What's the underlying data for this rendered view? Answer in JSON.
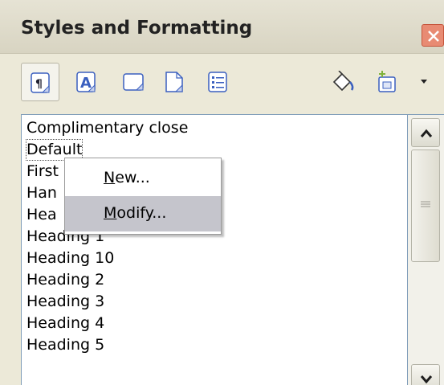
{
  "window": {
    "title": "Styles and Formatting"
  },
  "toolbar": {
    "buttons": [
      {
        "name": "paragraph-styles-icon",
        "active": true
      },
      {
        "name": "character-styles-icon",
        "active": false
      },
      {
        "name": "frame-styles-icon",
        "active": false
      },
      {
        "name": "page-styles-icon",
        "active": false
      },
      {
        "name": "list-styles-icon",
        "active": false
      },
      {
        "name": "fill-format-mode-icon",
        "active": false
      },
      {
        "name": "new-style-from-selection-icon",
        "active": false
      },
      {
        "name": "dropdown-arrow-icon",
        "active": false
      }
    ]
  },
  "styles_list": {
    "items": [
      "Complimentary close",
      "Default",
      "First",
      "Han",
      "Hea",
      "Heading 1",
      "Heading 10",
      "Heading 2",
      "Heading 3",
      "Heading 4",
      "Heading 5"
    ],
    "selected": "Default"
  },
  "context_menu": {
    "items": [
      {
        "label": "New...",
        "mnemonic": "N"
      },
      {
        "label": "Modify...",
        "mnemonic": "M"
      }
    ],
    "highlighted": "Modify..."
  },
  "colors": {
    "accent_border": "#7f9db9",
    "menu_highlight": "#c5c5cc",
    "close_button": "#e88b73",
    "icon_blue": "#3a5fbf"
  }
}
